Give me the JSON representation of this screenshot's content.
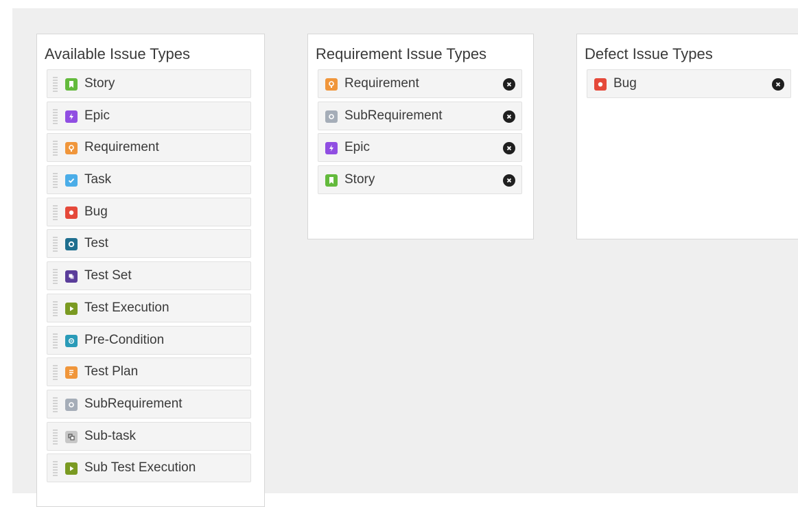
{
  "panels": {
    "available": {
      "title": "Available Issue Types",
      "items": [
        {
          "label": "Story",
          "icon": "story-icon",
          "color": "#63ba3c"
        },
        {
          "label": "Epic",
          "icon": "epic-icon",
          "color": "#904ee2"
        },
        {
          "label": "Requirement",
          "icon": "requirement-icon",
          "color": "#f0963b"
        },
        {
          "label": "Task",
          "icon": "task-icon",
          "color": "#4bade8"
        },
        {
          "label": "Bug",
          "icon": "bug-icon",
          "color": "#e5493a"
        },
        {
          "label": "Test",
          "icon": "test-icon",
          "color": "#1f6f8f"
        },
        {
          "label": "Test Set",
          "icon": "test-set-icon",
          "color": "#5a3d9a"
        },
        {
          "label": "Test Execution",
          "icon": "test-execution-icon",
          "color": "#7a9a22"
        },
        {
          "label": "Pre-Condition",
          "icon": "pre-condition-icon",
          "color": "#2a9bb8"
        },
        {
          "label": "Test Plan",
          "icon": "test-plan-icon",
          "color": "#f0963b"
        },
        {
          "label": "SubRequirement",
          "icon": "subrequirement-icon",
          "color": "#a5adb8"
        },
        {
          "label": "Sub-task",
          "icon": "sub-task-icon",
          "color": "#c7c7c7"
        },
        {
          "label": "Sub Test Execution",
          "icon": "sub-test-execution-icon",
          "color": "#7a9a22"
        }
      ]
    },
    "requirement": {
      "title": "Requirement Issue Types",
      "items": [
        {
          "label": "Requirement",
          "icon": "requirement-icon",
          "color": "#f0963b"
        },
        {
          "label": "SubRequirement",
          "icon": "subrequirement-icon",
          "color": "#a5adb8"
        },
        {
          "label": "Epic",
          "icon": "epic-icon",
          "color": "#904ee2"
        },
        {
          "label": "Story",
          "icon": "story-icon",
          "color": "#63ba3c"
        }
      ]
    },
    "defect": {
      "title": "Defect Issue Types",
      "items": [
        {
          "label": "Bug",
          "icon": "bug-icon",
          "color": "#e5493a"
        }
      ]
    }
  },
  "remove_icon": "close-circle-icon"
}
